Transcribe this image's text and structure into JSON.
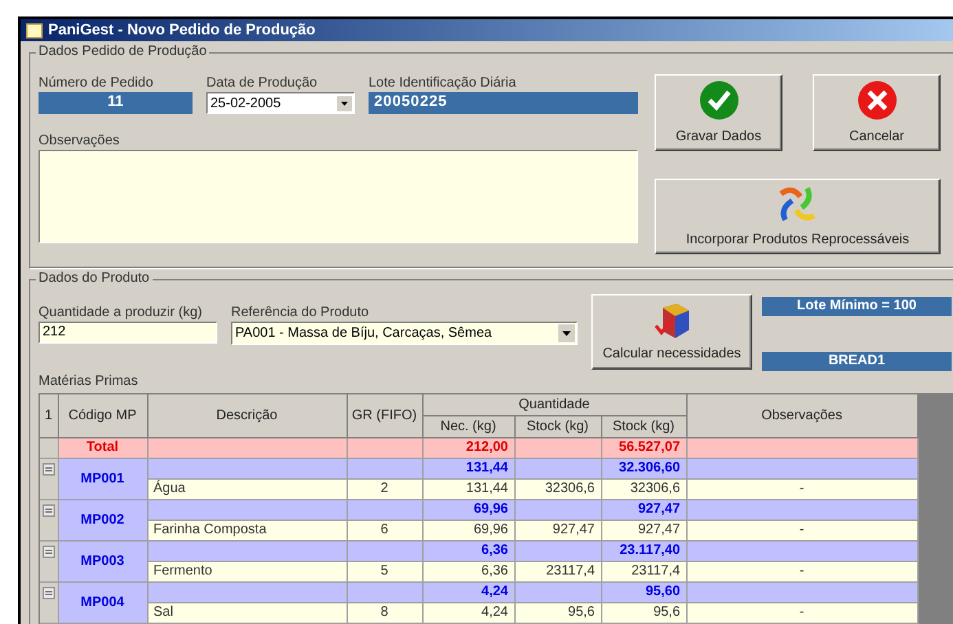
{
  "window": {
    "title": "PaniGest - Novo Pedido de Produção"
  },
  "order_group": {
    "title": "Dados Pedido de Produção",
    "order_number": {
      "label": "Número de Pedido",
      "value": "11"
    },
    "production_date": {
      "label": "Data de Produção",
      "value": "25-02-2005"
    },
    "daily_lot": {
      "label": "Lote Identificação Diária",
      "value": "20050225"
    },
    "notes": {
      "label": "Observações"
    }
  },
  "buttons": [
    {
      "kind": "save",
      "label": "Gravar Dados"
    },
    {
      "kind": "cancel",
      "label": "Cancelar"
    },
    {
      "kind": "reprocess",
      "label": "Incorporar Produtos Reprocessáveis"
    }
  ],
  "product_group": {
    "title": "Dados do Produto",
    "quantity": {
      "label": "Quantidade a produzir (kg)",
      "value": "212"
    },
    "product_ref": {
      "label": "Referência do Produto",
      "value": "PA001 - Massa de Bíju, Carcaças, Sêmea"
    },
    "calculate_button": "Calcular necessidades",
    "min_lot": "Lote Mínimo = 100",
    "recipe": "BREAD1",
    "grid_label": "Matérias Primas"
  },
  "table": {
    "corner": "1",
    "columns": [
      "Código MP",
      "Descrição",
      "GR (FIFO)",
      "Nec. (kg)",
      "Stock (kg)",
      "Stock (kg)",
      "Observações"
    ],
    "column_group": "Quantidade",
    "total": {
      "label": "Total",
      "nec": "212,00",
      "stock": "56.527,07"
    },
    "groups": [
      {
        "code": "MP001",
        "nec": "131,44",
        "stock": "32.306,60",
        "expanded": true,
        "detail": {
          "description": "Água",
          "gr": "2",
          "nec": "131,44",
          "stock_1": "32306,6",
          "stock_2": "32306,6",
          "notes": "-"
        }
      },
      {
        "code": "MP002",
        "nec": "69,96",
        "stock": "927,47",
        "expanded": true,
        "detail": {
          "description": "Farinha Composta",
          "gr": "6",
          "nec": "69,96",
          "stock_1": "927,47",
          "stock_2": "927,47",
          "notes": "-"
        }
      },
      {
        "code": "MP003",
        "nec": "6,36",
        "stock": "23.117,40",
        "expanded": true,
        "detail": {
          "description": "Fermento",
          "gr": "5",
          "nec": "6,36",
          "stock_1": "23117,4",
          "stock_2": "23117,4",
          "notes": "-"
        }
      },
      {
        "code": "MP004",
        "nec": "4,24",
        "stock": "95,60",
        "expanded": true,
        "detail": {
          "description": "Sal",
          "gr": "8",
          "nec": "4,24",
          "stock_1": "95,6",
          "stock_2": "95,6",
          "notes": "-"
        }
      }
    ]
  }
}
